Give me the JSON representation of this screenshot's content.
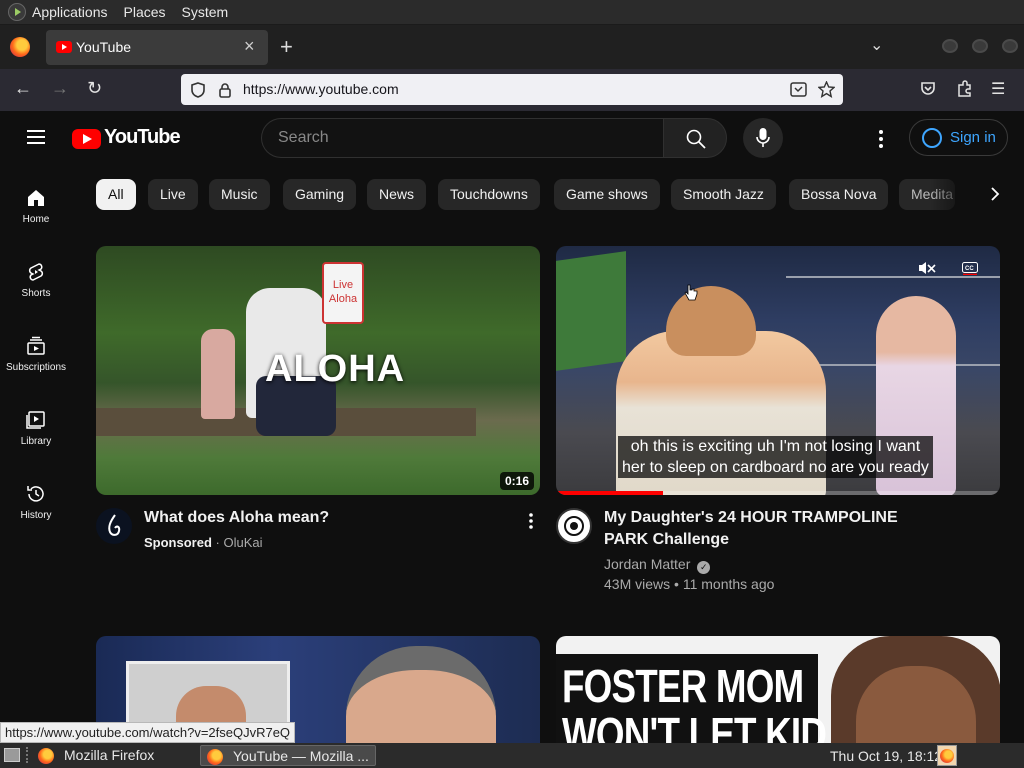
{
  "os_panel": {
    "menus": [
      "Applications",
      "Places",
      "System"
    ]
  },
  "browser": {
    "tab_title": "YouTube",
    "tab_close": "×",
    "new_tab": "+",
    "tab_list": "⌄",
    "url": "https://www.youtube.com",
    "nav": {
      "back": "←",
      "forward": "→",
      "reload": "↻",
      "menu": "☰"
    }
  },
  "youtube": {
    "logo_text": "YouTube",
    "search_placeholder": "Search",
    "sign_in": "Sign in",
    "sidebar": [
      {
        "label": "Home",
        "icon": "home-icon"
      },
      {
        "label": "Shorts",
        "icon": "shorts-icon"
      },
      {
        "label": "Subscriptions",
        "icon": "subscriptions-icon"
      },
      {
        "label": "Library",
        "icon": "library-icon"
      },
      {
        "label": "History",
        "icon": "history-icon"
      }
    ],
    "chips": [
      "All",
      "Live",
      "Music",
      "Gaming",
      "News",
      "Touchdowns",
      "Game shows",
      "Smooth Jazz",
      "Bossa Nova",
      "Medita"
    ],
    "videos": [
      {
        "title": "What does Aloha mean?",
        "sponsored": "Sponsored",
        "channel": "OluKai",
        "duration": "0:16",
        "overlay_text": "ALOHA",
        "sign_text": "Live Aloha"
      },
      {
        "title": "My Daughter's 24 HOUR TRAMPOLINE PARK Challenge",
        "channel": "Jordan Matter",
        "views": "43M views",
        "age": "11 months ago",
        "caption_line1": "oh this is exciting uh I'm not losing I want",
        "caption_line2": "her to sleep on cardboard no are you ready",
        "progress": 0.24
      },
      {
        "title_overlay": ""
      },
      {
        "title_overlay": "FOSTER MOM",
        "title_overlay2": "WON'T LET KID"
      }
    ]
  },
  "status_url": "https://www.youtube.com/watch?v=2fseQJvR7eQ",
  "taskbar": {
    "items": [
      "Mozilla Firefox",
      "YouTube — Mozilla ..."
    ],
    "clock": "Thu Oct 19, 18:12"
  },
  "colors": {
    "yt_red": "#ff0000",
    "link_blue": "#3ea6ff",
    "bg": "#0f0f0f"
  }
}
